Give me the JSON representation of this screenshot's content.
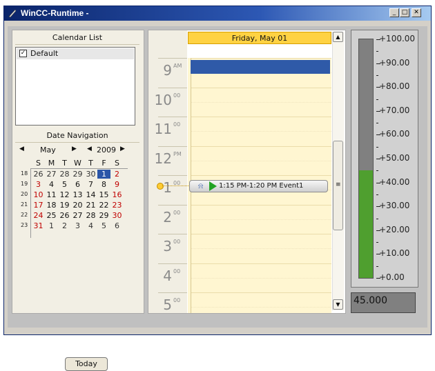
{
  "window": {
    "title": "WinCC-Runtime -",
    "min_label": "_",
    "max_label": "□",
    "close_label": "✕"
  },
  "calendar_list": {
    "header": "Calendar List",
    "items": [
      {
        "label": "Default",
        "checked": true
      }
    ]
  },
  "date_navigation": {
    "header": "Date Navigation",
    "month": "May",
    "year": "2009",
    "weekday_headers": [
      "S",
      "M",
      "T",
      "W",
      "T",
      "F",
      "S"
    ],
    "week_numbers": [
      "18",
      "19",
      "20",
      "21",
      "22",
      "23"
    ],
    "weeks": [
      [
        "26",
        "27",
        "28",
        "29",
        "30",
        "1",
        "2"
      ],
      [
        "3",
        "4",
        "5",
        "6",
        "7",
        "8",
        "9"
      ],
      [
        "10",
        "11",
        "12",
        "13",
        "14",
        "15",
        "16"
      ],
      [
        "17",
        "18",
        "19",
        "20",
        "21",
        "22",
        "23"
      ],
      [
        "24",
        "25",
        "26",
        "27",
        "28",
        "29",
        "30"
      ],
      [
        "31",
        "1",
        "2",
        "3",
        "4",
        "5",
        "6"
      ]
    ],
    "selected_day": "1",
    "today_button": "Today"
  },
  "day_view": {
    "date_header": "Friday, May 01",
    "hours": [
      {
        "hour": "9",
        "suffix": "AM"
      },
      {
        "hour": "10",
        "suffix": "00"
      },
      {
        "hour": "11",
        "suffix": "00"
      },
      {
        "hour": "12",
        "suffix": "PM"
      },
      {
        "hour": "1",
        "suffix": "00"
      },
      {
        "hour": "2",
        "suffix": "00"
      },
      {
        "hour": "3",
        "suffix": "00"
      },
      {
        "hour": "4",
        "suffix": "00"
      },
      {
        "hour": "5",
        "suffix": "00"
      }
    ],
    "event": {
      "text": "1:15 PM-1:20 PM Event1",
      "icon": "bell-icon"
    },
    "thumb_grip": "≡"
  },
  "bar_gauge": {
    "labels": [
      "+100.00",
      "+90.00",
      "+80.00",
      "+70.00",
      "+60.00",
      "+50.00",
      "+40.00",
      "+30.00",
      "+20.00",
      "+10.00",
      "+0.00"
    ],
    "min": 0,
    "max": 100,
    "value": 45,
    "fill_color": "#4f9f2f",
    "background_color": "#808080",
    "value_display": "45.000"
  }
}
